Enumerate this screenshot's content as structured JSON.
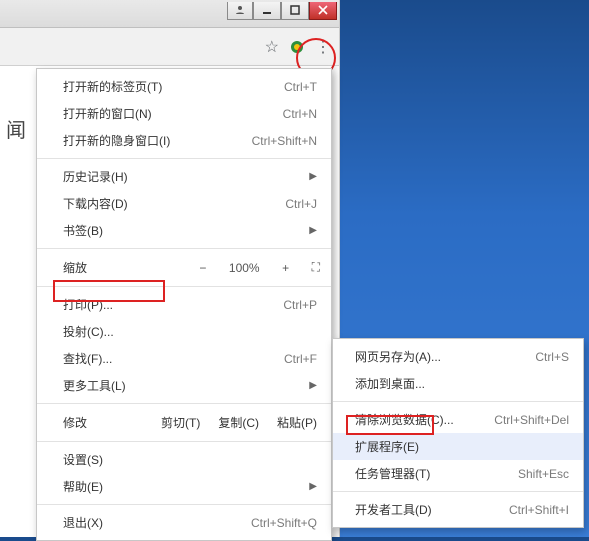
{
  "page": {
    "truncated_label": "闻"
  },
  "menu": {
    "new_tab": {
      "label": "打开新的标签页(T)",
      "shortcut": "Ctrl+T"
    },
    "new_window": {
      "label": "打开新的窗口(N)",
      "shortcut": "Ctrl+N"
    },
    "incognito": {
      "label": "打开新的隐身窗口(I)",
      "shortcut": "Ctrl+Shift+N"
    },
    "history": {
      "label": "历史记录(H)"
    },
    "downloads": {
      "label": "下载内容(D)",
      "shortcut": "Ctrl+J"
    },
    "bookmarks": {
      "label": "书签(B)"
    },
    "zoom": {
      "label": "缩放",
      "value": "100%"
    },
    "print": {
      "label": "打印(P)...",
      "shortcut": "Ctrl+P"
    },
    "cast": {
      "label": "投射(C)..."
    },
    "find": {
      "label": "查找(F)...",
      "shortcut": "Ctrl+F"
    },
    "more_tools": {
      "label": "更多工具(L)"
    },
    "edit": {
      "label": "修改",
      "cut": "剪切(T)",
      "copy": "复制(C)",
      "paste": "粘贴(P)"
    },
    "settings": {
      "label": "设置(S)"
    },
    "help": {
      "label": "帮助(E)"
    },
    "exit": {
      "label": "退出(X)",
      "shortcut": "Ctrl+Shift+Q"
    }
  },
  "submenu": {
    "save_as": {
      "label": "网页另存为(A)...",
      "shortcut": "Ctrl+S"
    },
    "add_desktop": {
      "label": "添加到桌面..."
    },
    "clear_data": {
      "label": "清除浏览数据(C)...",
      "shortcut": "Ctrl+Shift+Del"
    },
    "extensions": {
      "label": "扩展程序(E)"
    },
    "task_mgr": {
      "label": "任务管理器(T)",
      "shortcut": "Shift+Esc"
    },
    "dev_tools": {
      "label": "开发者工具(D)",
      "shortcut": "Ctrl+Shift+I"
    }
  }
}
